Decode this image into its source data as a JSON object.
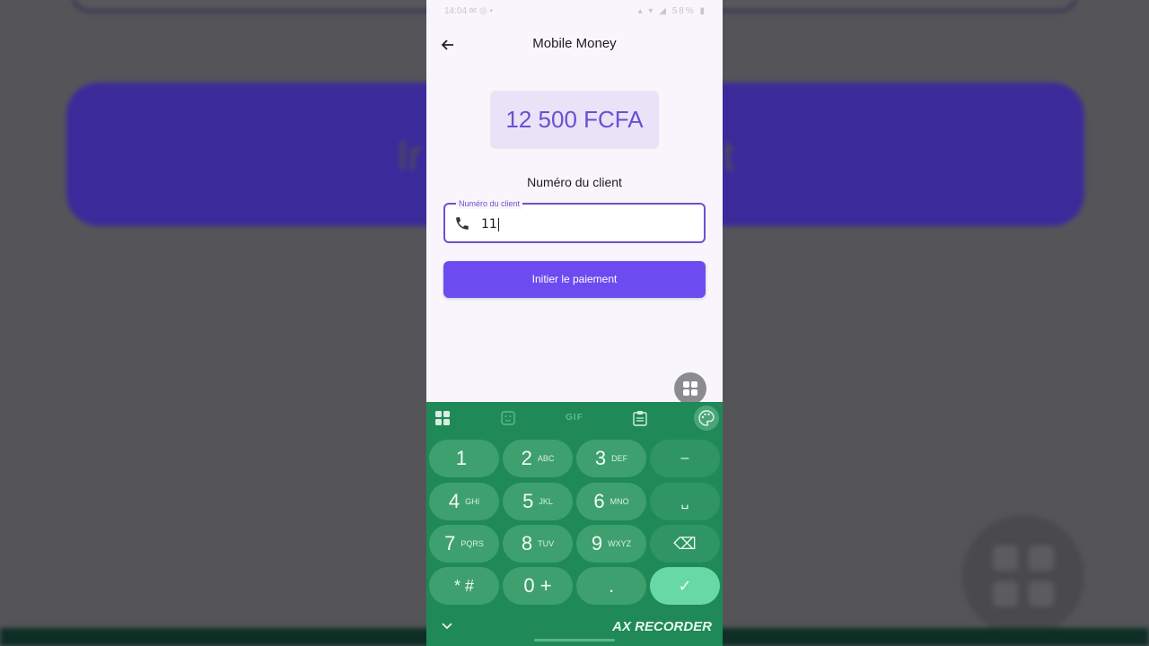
{
  "background": {
    "button_text_left": "Ir",
    "button_text_right": "nt"
  },
  "statusbar": {
    "time": "14:04 ✉ ◎ •",
    "icons": "▴ ▾ ◢ 58% ▮"
  },
  "appbar": {
    "title": "Mobile Money",
    "back_icon": "arrow-left-icon"
  },
  "amount": "12 500 FCFA",
  "client_section_title": "Numéro du client",
  "phone_field": {
    "legend": "Numéro du client",
    "value": "11",
    "icon": "phone-icon"
  },
  "pay_button": "Initier le paiement",
  "keyboard": {
    "toolbar": {
      "gif_label": "GIF"
    },
    "keys": [
      {
        "main": "1",
        "sub": ""
      },
      {
        "main": "2",
        "sub": "ABC"
      },
      {
        "main": "3",
        "sub": "DEF"
      },
      {
        "main": "–",
        "sub": ""
      },
      {
        "main": "4",
        "sub": "GHI"
      },
      {
        "main": "5",
        "sub": "JKL"
      },
      {
        "main": "6",
        "sub": "MNO"
      },
      {
        "main": "␣",
        "sub": ""
      },
      {
        "main": "7",
        "sub": "PQRS"
      },
      {
        "main": "8",
        "sub": "TUV"
      },
      {
        "main": "9",
        "sub": "WXYZ"
      },
      {
        "main": "⌫",
        "sub": ""
      },
      {
        "main": "* #",
        "sub": ""
      },
      {
        "main": "0 +",
        "sub": ""
      },
      {
        "main": ".",
        "sub": ""
      },
      {
        "main": "✓",
        "sub": ""
      }
    ]
  },
  "watermark": "AX RECORDER",
  "colors": {
    "accent": "#6c4bf0",
    "keyboard": "#1f8a57",
    "amount_text": "#6b4fd2"
  }
}
